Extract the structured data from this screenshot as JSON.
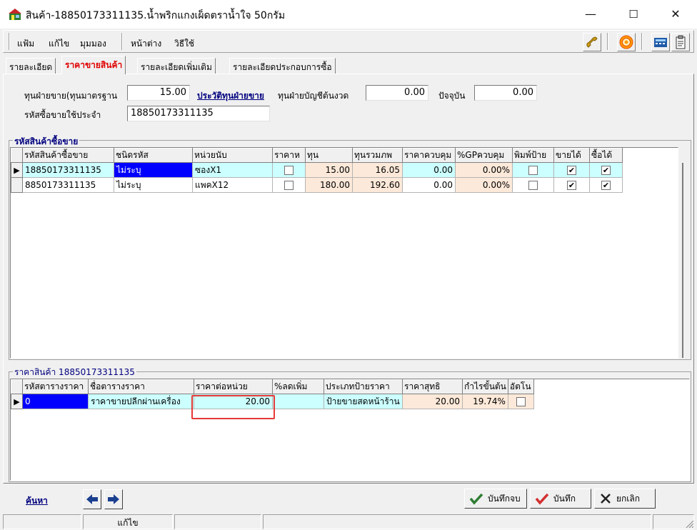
{
  "window": {
    "title": "สินค้า-18850173311135.น้ำพริกแกงเผ็ดตราน้ำใจ 50กรัม",
    "min": "—",
    "max": "☐",
    "close": "✕"
  },
  "menu": {
    "file": "แฟ้ม",
    "edit": "แก้ไข",
    "view": "มุมมอง",
    "window": "หน้าต่าง",
    "help": "วิธีใช้"
  },
  "tabs": [
    "รายละเอียด",
    "ราคาขายสินค้า",
    "รายละเอียดเพิ่มเติม",
    "รายละเอียดประกอบการซื้อ"
  ],
  "header": {
    "std_cost_label": "ทุนฝ่ายขาย(ทุนมาตรฐาน",
    "std_cost": "15.00",
    "history_link": "ประวัติทุนฝ่ายขาย",
    "acct_cost_label": "ทุนฝ่ายบัญชีต้นงวด",
    "acct_cost": "0.00",
    "current_label": "ปัจจุบัน",
    "current": "0.00",
    "default_code_label": "รหัสซื้อขายใช้ประจำ",
    "default_code": "18850173311135"
  },
  "codes": {
    "title": "รหัสสินค้าซื้อขาย",
    "columns": [
      "รหัสสินค้าซื้อขาย",
      "ชนิดรหัส",
      "หน่วยนับ",
      "ราคาห",
      "ทุน",
      "ทุนรวมภพ",
      "ราคาควบคุม",
      "%GPควบคุม",
      "พิมพ์ป้าย",
      "ขายได้",
      "ซื้อได้"
    ],
    "rows": [
      {
        "code": "18850173311135",
        "type": "ไม่ระบุ",
        "unit": "ซองX1",
        "price_flag": false,
        "cost": "15.00",
        "cost_vat": "16.05",
        "ctrl_price": "0.00",
        "ctrl_gp": "0.00%",
        "print": false,
        "sell": true,
        "buy": true
      },
      {
        "code": "8850173311135",
        "type": "ไม่ระบุ",
        "unit": "แพคX12",
        "price_flag": false,
        "cost": "180.00",
        "cost_vat": "192.60",
        "ctrl_price": "0.00",
        "ctrl_gp": "0.00%",
        "print": false,
        "sell": true,
        "buy": true
      }
    ]
  },
  "prices": {
    "title": "ราคาสินค้า 18850173311135",
    "columns": [
      "รหัสตารางราคา",
      "ชื่อตารางราคา",
      "ราคาต่อหน่วย",
      "%ลดเพิ่ม",
      "ประเภทป้ายราคา",
      "ราคาสุทธิ",
      "กำไรขั้นต้น",
      "อัตโน"
    ],
    "rows": [
      {
        "code": "0",
        "name": "ราคาขายปลีกผ่านเครื่อง",
        "unit_price": "20.00",
        "disc": "",
        "label_type": "ป้ายขายสดหน้าร้าน",
        "net": "20.00",
        "gp": "19.74%",
        "auto": false
      }
    ]
  },
  "bottom": {
    "search": "ค้นหา",
    "save_close": "บันทึกจบ",
    "save": "บันทึก",
    "cancel": "ยกเลิก"
  },
  "status": {
    "mode": "แก้ไข"
  },
  "colors": {
    "highlight_border": "#e53935",
    "active_tab": "#e00000",
    "selected_cell": "#0000ff"
  }
}
